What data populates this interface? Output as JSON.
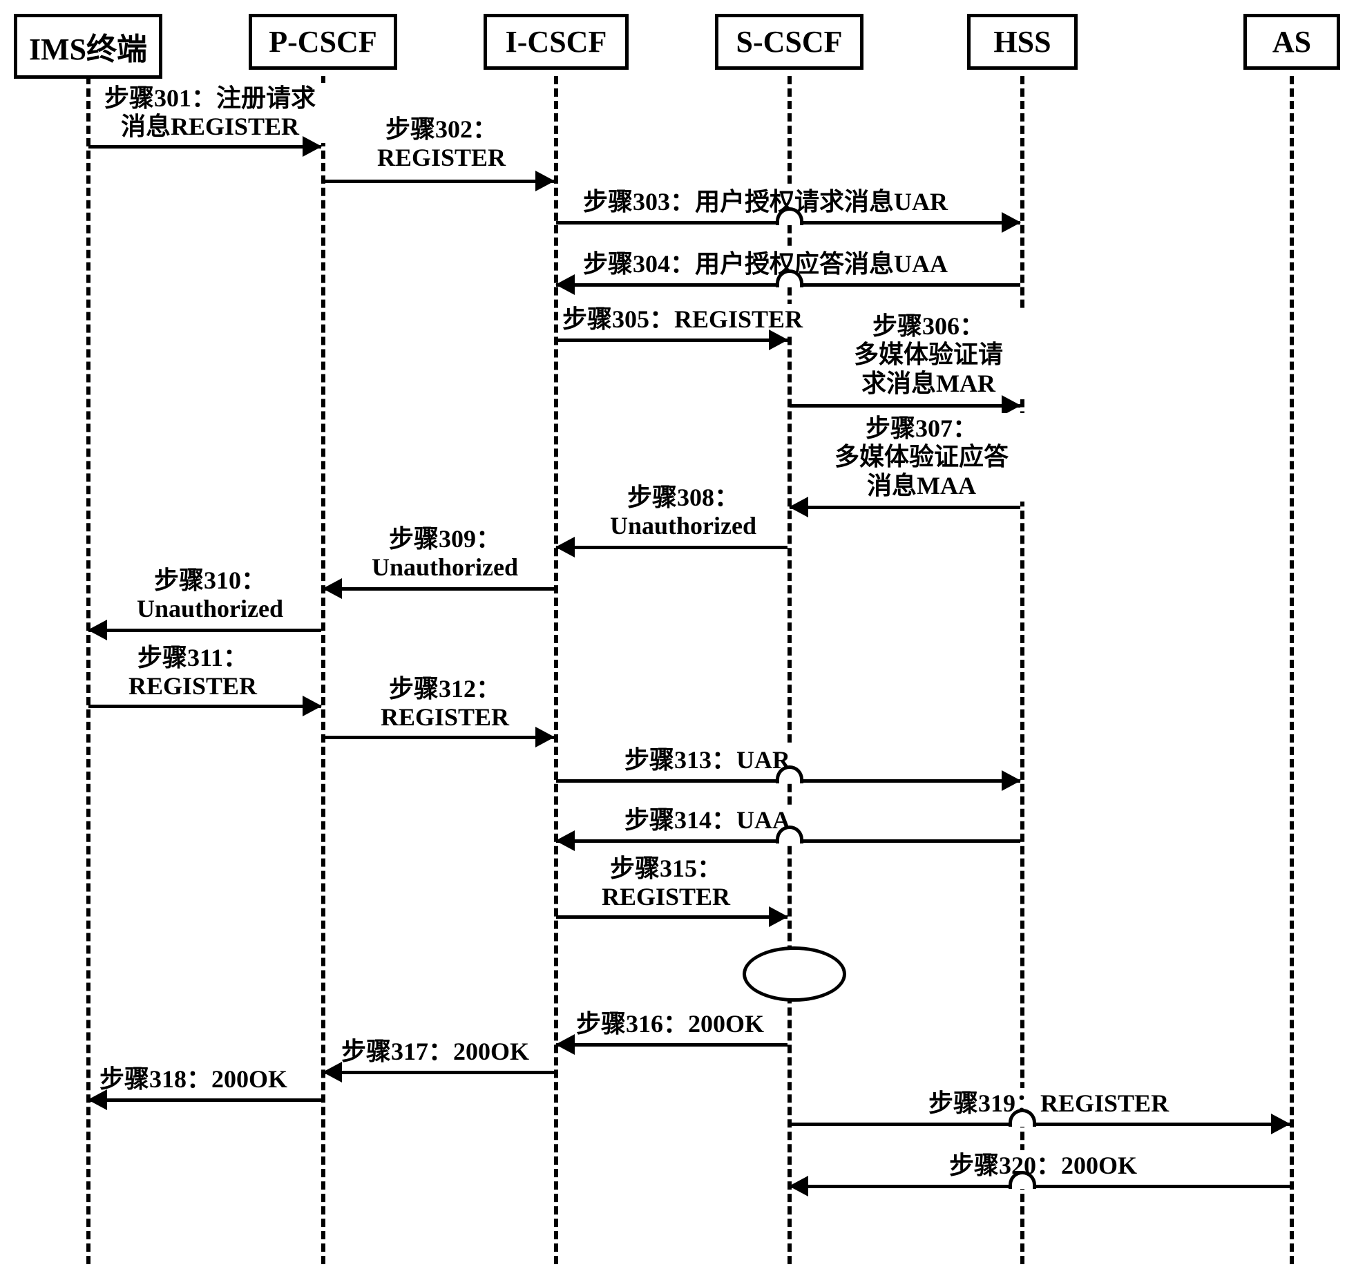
{
  "participants": {
    "ims": "IMS终端",
    "pcscf": "P-CSCF",
    "icscf": "I-CSCF",
    "scscf": "S-CSCF",
    "hss": "HSS",
    "as": "AS"
  },
  "messages": {
    "m301": "步骤301：注册请求\n消息REGISTER",
    "m302": "步骤302：\nREGISTER",
    "m303": "步骤303：用户授权请求消息UAR",
    "m304": "步骤304：用户授权应答消息UAA",
    "m305": "步骤305：REGISTER",
    "m306": "步骤306：\n多媒体验证请\n求消息MAR",
    "m307": "步骤307：\n多媒体验证应答\n消息MAA",
    "m308": "步骤308：\nUnauthorized",
    "m309": "步骤309：\nUnauthorized",
    "m310": "步骤310：\nUnauthorized",
    "m311": "步骤311：\nREGISTER",
    "m312": "步骤312：\nREGISTER",
    "m313": "步骤313：UAR",
    "m314": "步骤314：UAA",
    "m315": "步骤315：\nREGISTER",
    "m316": "步骤316：200OK",
    "m317": "步骤317：200OK",
    "m318": "步骤318：200OK",
    "m319": "步骤319：REGISTER",
    "m320": "步骤320：200OK"
  }
}
